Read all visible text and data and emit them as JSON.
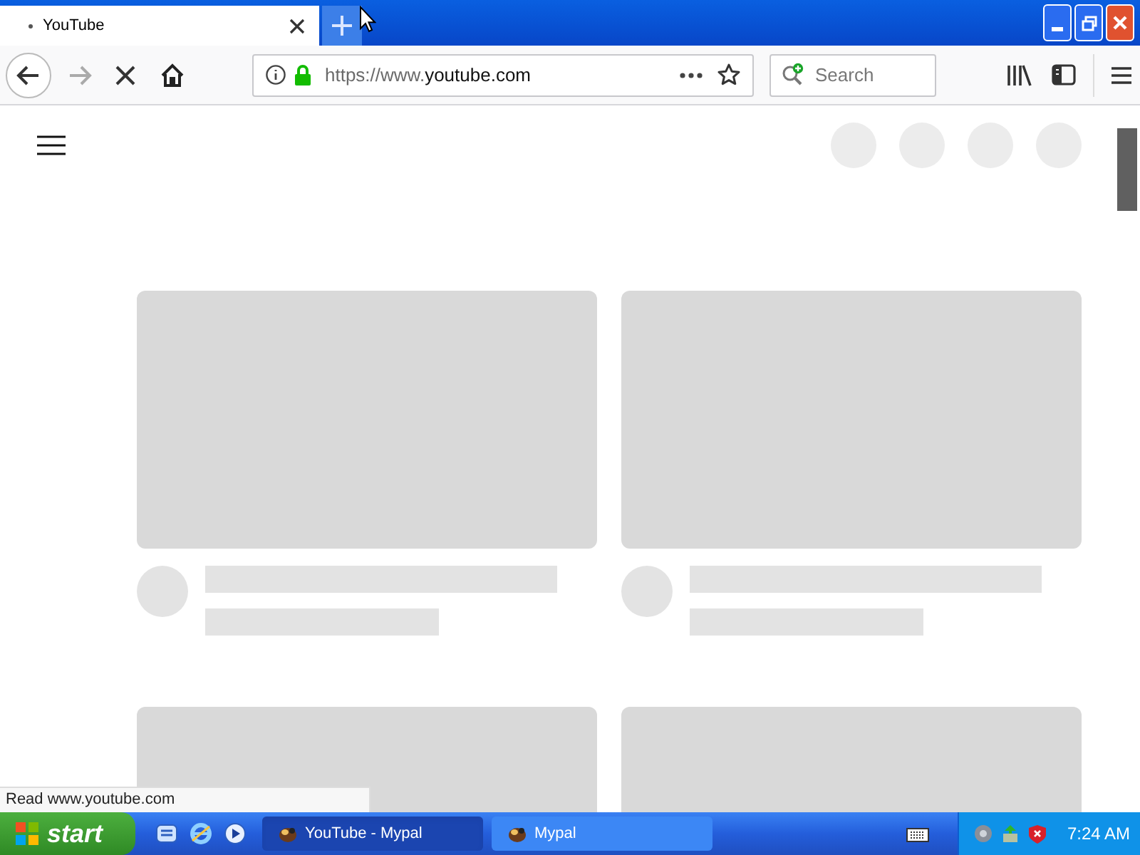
{
  "tab": {
    "title": "YouTube",
    "selected": true
  },
  "address_bar": {
    "url_prefix": "https://www.",
    "url_domain": "youtube.com"
  },
  "search": {
    "placeholder": "Search"
  },
  "status_text": "Read www.youtube.com",
  "taskbar": {
    "start": "start",
    "tasks": [
      {
        "label": "YouTube - Mypal",
        "selected": true
      },
      {
        "label": "Mypal",
        "selected": false
      }
    ],
    "clock": "7:24 AM"
  }
}
